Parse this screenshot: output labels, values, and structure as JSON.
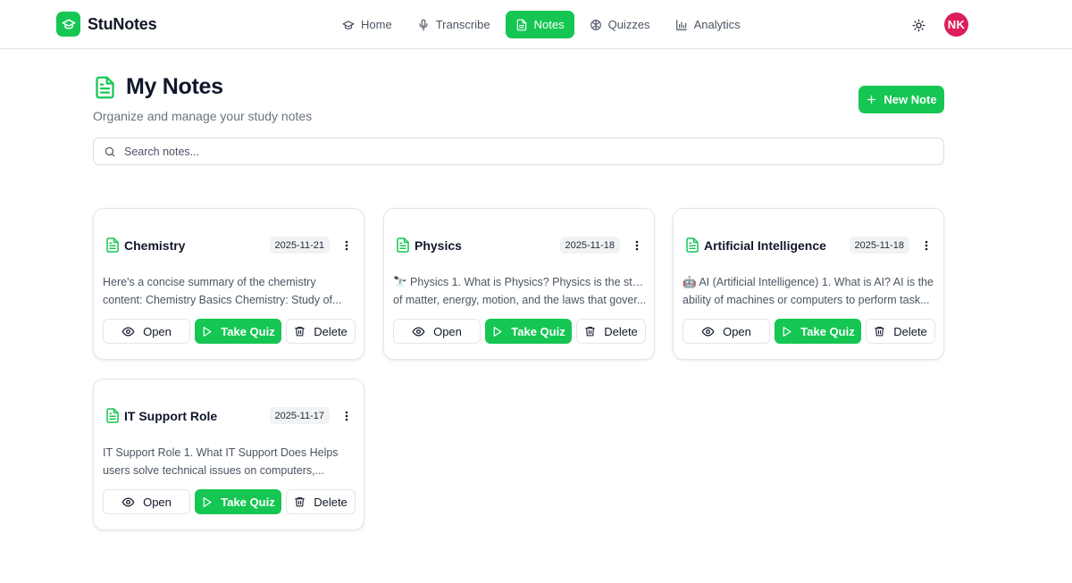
{
  "app": {
    "name": "StuNotes"
  },
  "nav": [
    {
      "label": "Home",
      "icon": "graduation-cap-icon",
      "active": false
    },
    {
      "label": "Transcribe",
      "icon": "microphone-icon",
      "active": false
    },
    {
      "label": "Notes",
      "icon": "file-text-icon",
      "active": true
    },
    {
      "label": "Quizzes",
      "icon": "brain-icon",
      "active": false
    },
    {
      "label": "Analytics",
      "icon": "bar-chart-icon",
      "active": false
    }
  ],
  "user": {
    "initials": "NK"
  },
  "page": {
    "title": "My Notes",
    "subtitle": "Organize and manage your study notes",
    "new_note_label": "New Note"
  },
  "search": {
    "placeholder": "Search notes...",
    "value": ""
  },
  "actions": {
    "open": "Open",
    "quiz": "Take Quiz",
    "delete": "Delete"
  },
  "notes": [
    {
      "title": "Chemistry",
      "date": "2025-11-21",
      "preview_line1": "Here's a concise summary of the chemistry",
      "preview_line2": "content: Chemistry Basics Chemistry: Study of..."
    },
    {
      "title": "Physics",
      "date": "2025-11-18",
      "preview_line1": "🔭 Physics 1. What is Physics? Physics is the study",
      "preview_line2": "of matter, energy, motion, and the laws that gover..."
    },
    {
      "title": "Artificial Intelligence",
      "date": "2025-11-18",
      "preview_line1": "🤖 AI (Artificial Intelligence) 1. What is AI? AI is the",
      "preview_line2": "ability of machines or computers to perform task..."
    },
    {
      "title": "IT Support Role",
      "date": "2025-11-17",
      "preview_line1": "IT Support Role 1. What IT Support Does Helps",
      "preview_line2": "users solve technical issues on computers,..."
    }
  ],
  "colors": {
    "accent": "#16c653",
    "avatar": "#dc1e5a",
    "text_muted": "#6b7280"
  }
}
